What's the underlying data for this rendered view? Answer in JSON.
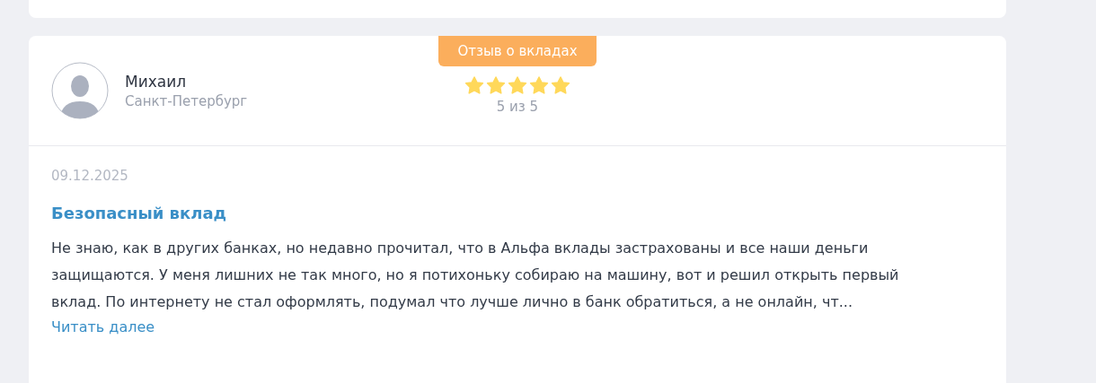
{
  "review": {
    "category": "Отзыв о вкладах",
    "author": "Михаил",
    "city": "Санкт-Петербург",
    "stars": 5,
    "rating_text": "5 из 5",
    "date": "09.12.2025",
    "title": "Безопасный вклад",
    "text": "Не знаю, как в других банках, но недавно прочитал, что в Альфа вклады застрахованы и все наши деньги защищаются. У меня лишних не так много, но я потихоньку собираю на машину, вот и решил открыть первый вклад. По интернету не стал оформлять, подумал что лучше лично в банк обратиться, а не онлайн, чт...",
    "read_more": "Читать далее"
  }
}
